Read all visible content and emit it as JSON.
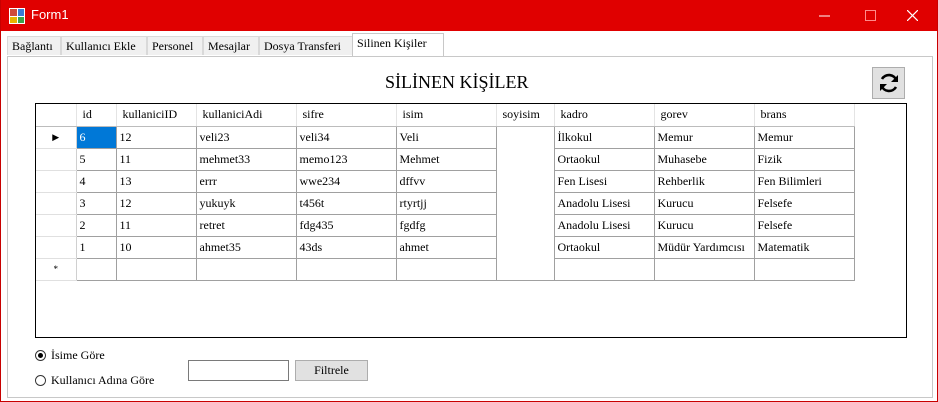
{
  "window": {
    "title": "Form1",
    "title_bar_color": "#e00000"
  },
  "tabs": [
    {
      "label": "Bağlantı",
      "active": false
    },
    {
      "label": "Kullanıcı Ekle",
      "active": false
    },
    {
      "label": "Personel",
      "active": false
    },
    {
      "label": "Mesajlar",
      "active": false
    },
    {
      "label": "Dosya Transferi",
      "active": false
    },
    {
      "label": "Silinen Kişiler",
      "active": true
    }
  ],
  "page": {
    "heading": "SİLİNEN KİŞİLER",
    "refresh_icon": "refresh-icon"
  },
  "grid": {
    "columns": [
      "id",
      "kullaniciID",
      "kullaniciAdi",
      "sifre",
      "isim",
      "soyisim",
      "kadro",
      "gorev",
      "brans"
    ],
    "rows": [
      [
        "6",
        "12",
        "veli23",
        "veli34",
        "Veli",
        "",
        "İlkokul",
        "Memur",
        "Memur"
      ],
      [
        "5",
        "11",
        "mehmet33",
        "memo123",
        "Mehmet",
        "",
        "Ortaokul",
        "Muhasebe",
        "Fizik"
      ],
      [
        "4",
        "13",
        "errr",
        "wwe234",
        "dffvv",
        "",
        "Fen Lisesi",
        "Rehberlik",
        "Fen Bilimleri"
      ],
      [
        "3",
        "12",
        "yukuyk",
        "t456t",
        "rtyrtjj",
        "",
        "Anadolu Lisesi",
        "Kurucu",
        "Felsefe"
      ],
      [
        "2",
        "11",
        "retret",
        "fdg435",
        "fgdfg",
        "",
        "Anadolu Lisesi",
        "Kurucu",
        "Felsefe"
      ],
      [
        "1",
        "10",
        "ahmet35",
        "43ds",
        "ahmet",
        "",
        "Ortaokul",
        "Müdür Yardımcısı",
        "Matematik"
      ]
    ],
    "current_row_indicator": "▶",
    "new_row_indicator": "*",
    "selected_cell_color": "#0078d7"
  },
  "filters": {
    "options": [
      {
        "label": "İsime Göre",
        "checked": true
      },
      {
        "label": "Kullanıcı Adına Göre",
        "checked": false
      }
    ],
    "input_value": "",
    "button_label": "Filtrele"
  }
}
